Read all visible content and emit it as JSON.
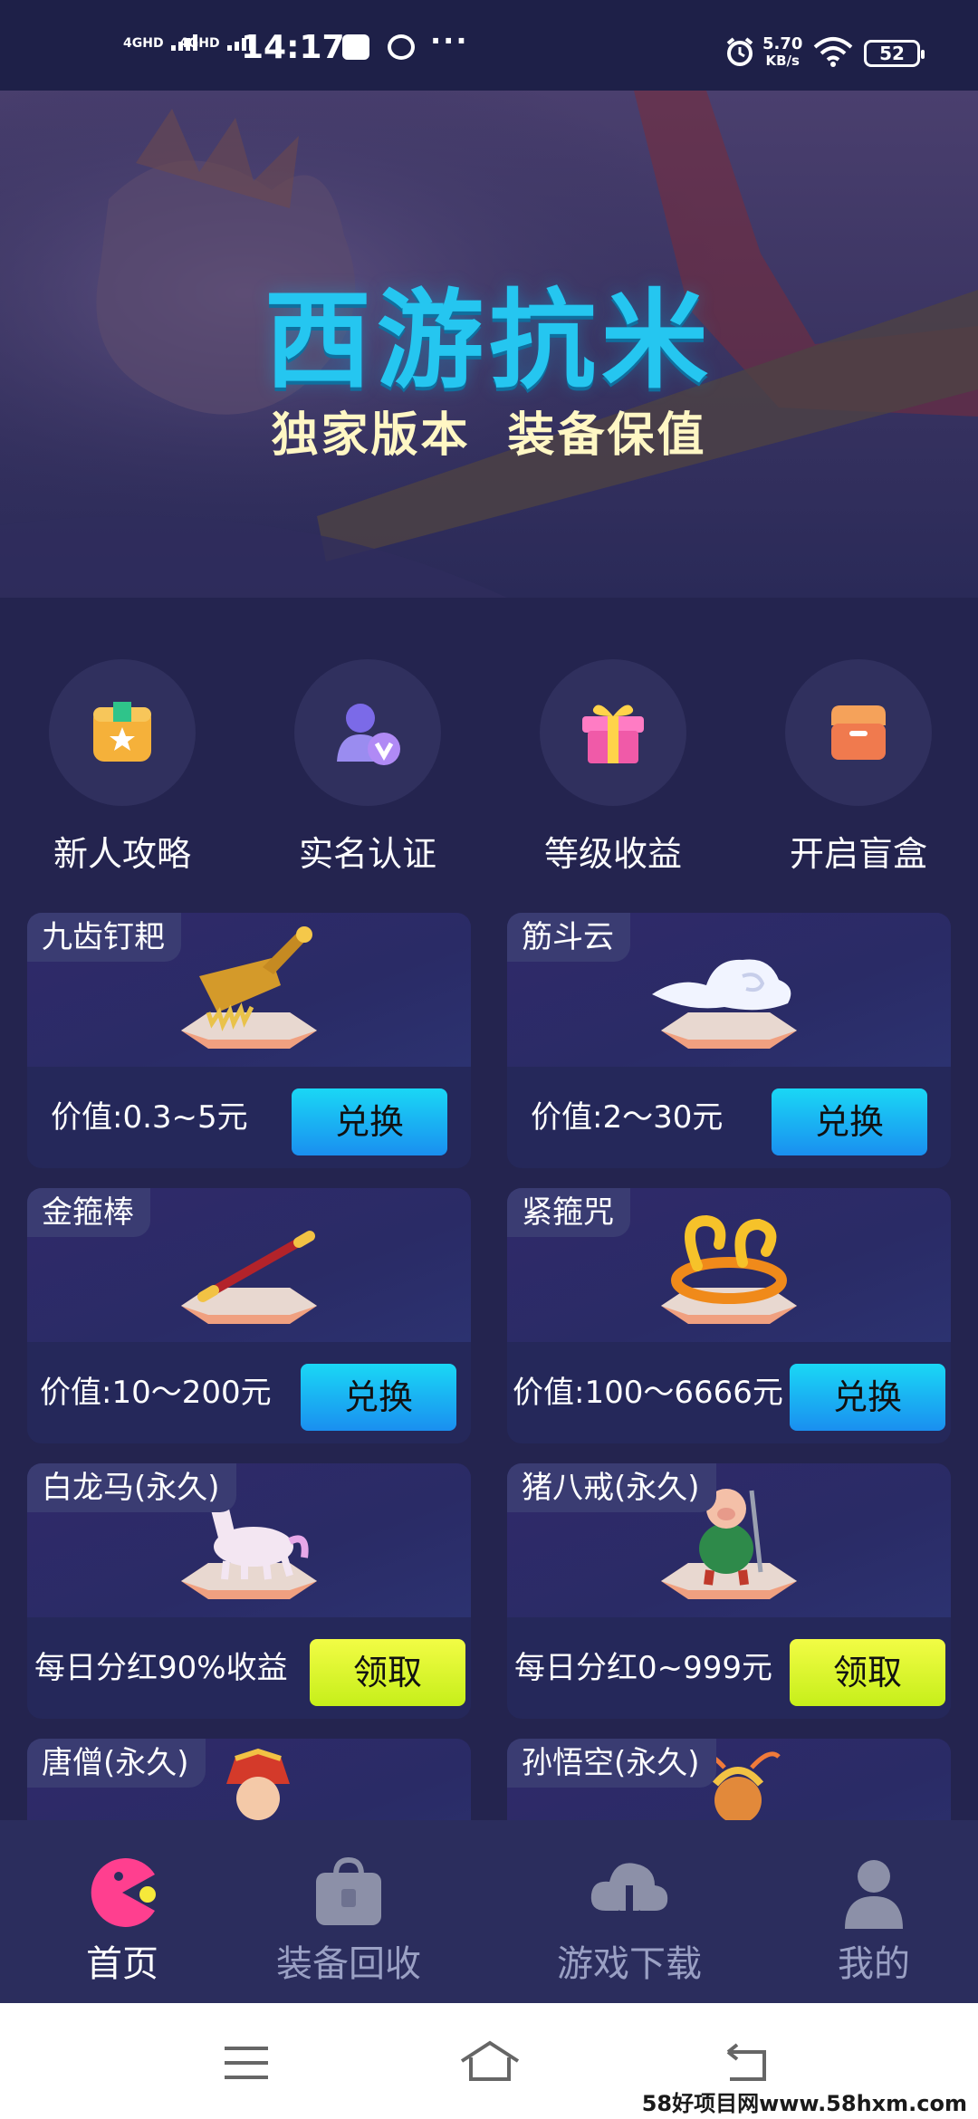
{
  "status_bar": {
    "signal1": "4GHD",
    "signal2": "4GHD",
    "time": "14:17",
    "more": "···",
    "net_speed_value": "5.70",
    "net_speed_unit": "KB/s",
    "battery": "52"
  },
  "banner": {
    "title": "西游抗米",
    "subtitle": "独家版本  装备保值"
  },
  "quick_actions": [
    {
      "label": "新人攻略",
      "icon": "star-box-icon",
      "color": "#f5b13a"
    },
    {
      "label": "实名认证",
      "icon": "user-verified-icon",
      "color": "#9a7cf0"
    },
    {
      "label": "等级收益",
      "icon": "gift-icon",
      "color": "#f06ab0"
    },
    {
      "label": "开启盲盒",
      "icon": "box-icon",
      "color": "#f07a4e"
    }
  ],
  "cards": [
    {
      "tag": "九齿钉耙",
      "price": "价值:0.3~5元",
      "button": "兑换",
      "button_style": "blue",
      "item": "rake"
    },
    {
      "tag": "筋斗云",
      "price": "价值:2～30元",
      "button": "兑换",
      "button_style": "blue",
      "item": "cloud"
    },
    {
      "tag": "金箍棒",
      "price": "价值:10～200元",
      "button": "兑换",
      "button_style": "blue",
      "item": "staff"
    },
    {
      "tag": "紧箍咒",
      "price": "价值:100～6666元",
      "button": "兑换",
      "button_style": "blue",
      "item": "ring"
    },
    {
      "tag": "白龙马(永久)",
      "price": "每日分红90%收益",
      "button": "领取",
      "button_style": "yellow",
      "item": "horse"
    },
    {
      "tag": "猪八戒(永久)",
      "price": "每日分红0~999元",
      "button": "领取",
      "button_style": "yellow",
      "item": "pig"
    },
    {
      "tag": "唐僧(永久)",
      "item": "monk"
    },
    {
      "tag": "孙悟空(永久)",
      "item": "monkey"
    }
  ],
  "bottom_nav": [
    {
      "label": "首页",
      "icon": "home-pacman-icon",
      "active": true
    },
    {
      "label": "装备回收",
      "icon": "bag-icon",
      "active": false
    },
    {
      "label": "游戏下载",
      "icon": "cloud-download-icon",
      "active": false
    },
    {
      "label": "我的",
      "icon": "profile-icon",
      "active": false
    }
  ],
  "watermark": "58好项目网www.58hxm.com",
  "colors": {
    "background": "#24244f",
    "accent_blue": "#1ad7f5",
    "accent_yellow": "#e6f83a",
    "title_cyan": "#25c6f0"
  }
}
